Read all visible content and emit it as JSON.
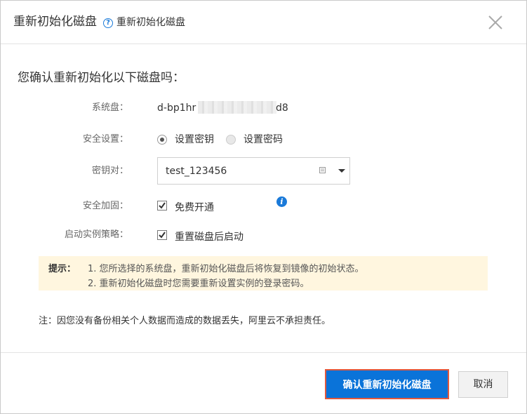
{
  "dialog": {
    "title": "重新初始化磁盘",
    "help_icon": "question-circle-icon",
    "subtitle": "重新初始化磁盘",
    "close_icon": "close-icon"
  },
  "body": {
    "question": "您确认重新初始化以下磁盘吗：",
    "system_disk": {
      "label": "系统盘：",
      "value_prefix": "d-bp1hr",
      "value_suffix": "d8"
    },
    "security_settings": {
      "label": "安全设置：",
      "options": [
        {
          "label": "设置密钥",
          "selected": true
        },
        {
          "label": "设置密码",
          "selected": false
        }
      ]
    },
    "key_pair": {
      "label": "密钥对：",
      "value": "test_123456"
    },
    "security_hardening": {
      "label": "安全加固：",
      "checkbox_label": "免费开通",
      "checked": true,
      "info_icon": "info-icon"
    },
    "startup_policy": {
      "label": "启动实例策略：",
      "checkbox_label": "重置磁盘后启动",
      "checked": true
    },
    "tip": {
      "label": "提示：",
      "lines": [
        "1. 您所选择的系统盘，重新初始化磁盘后将恢复到镜像的初始状态。",
        "2. 重新初始化磁盘时您需要重新设置实例的登录密码。"
      ]
    },
    "note": "注：因您没有备份相关个人数据而造成的数据丢失，阿里云不承担责任。"
  },
  "footer": {
    "confirm_label": "确认重新初始化磁盘",
    "cancel_label": "取消"
  },
  "colors": {
    "primary": "#0a73d9",
    "highlight_border": "#e2583d",
    "tip_background": "#fff6df"
  }
}
